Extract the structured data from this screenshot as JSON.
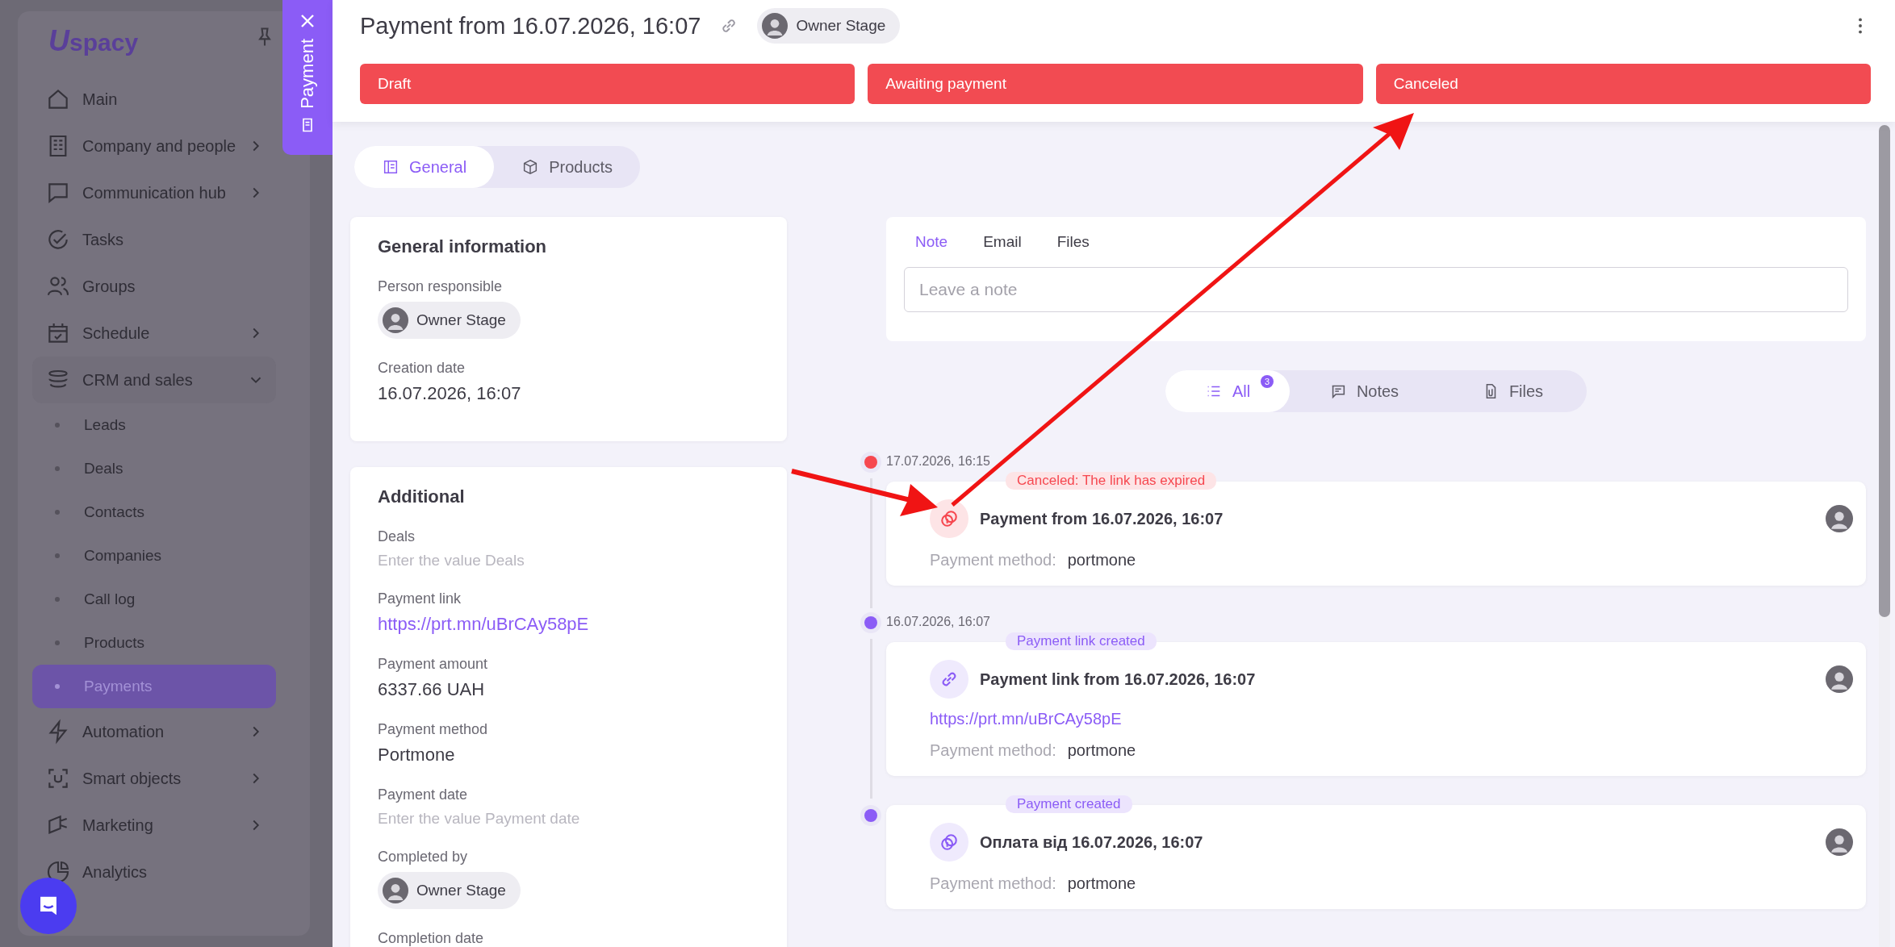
{
  "sidebar": {
    "logo": {
      "mark": "U",
      "text": "spacy"
    },
    "items": [
      {
        "label": "Main",
        "kind": "link",
        "selected": false
      },
      {
        "label": "Company and people",
        "kind": "group",
        "expanded": false,
        "selected": false
      },
      {
        "label": "Communication hub",
        "kind": "group",
        "expanded": false,
        "selected": false
      },
      {
        "label": "Tasks",
        "kind": "link",
        "selected": false
      },
      {
        "label": "Groups",
        "kind": "link",
        "selected": false
      },
      {
        "label": "Schedule",
        "kind": "group",
        "expanded": false,
        "selected": false
      },
      {
        "label": "CRM and sales",
        "kind": "group",
        "expanded": true,
        "selected": false,
        "children": [
          {
            "label": "Leads",
            "selected": false
          },
          {
            "label": "Deals",
            "selected": false
          },
          {
            "label": "Contacts",
            "selected": false
          },
          {
            "label": "Companies",
            "selected": false
          },
          {
            "label": "Call log",
            "selected": false
          },
          {
            "label": "Products",
            "selected": false
          },
          {
            "label": "Payments",
            "selected": true
          }
        ]
      },
      {
        "label": "Automation",
        "kind": "group",
        "expanded": false,
        "selected": false
      },
      {
        "label": "Smart objects",
        "kind": "group",
        "expanded": false,
        "selected": false
      },
      {
        "label": "Marketing",
        "kind": "group",
        "expanded": false,
        "selected": false
      },
      {
        "label": "Analytics",
        "kind": "link",
        "selected": false
      }
    ]
  },
  "panel_tab": {
    "label": "Payment"
  },
  "header": {
    "title": "Payment from 16.07.2026, 16:07",
    "owner": "Owner Stage"
  },
  "payment_canceled": true,
  "stages": [
    {
      "label": "Draft"
    },
    {
      "label": "Awaiting payment"
    },
    {
      "label": "Canceled"
    }
  ],
  "tabs": [
    {
      "label": "General",
      "selected": true
    },
    {
      "label": "Products",
      "selected": false
    }
  ],
  "general": {
    "title": "General information",
    "fields": [
      {
        "label": "Person responsible",
        "kind": "person",
        "value": "Owner Stage"
      },
      {
        "label": "Creation date",
        "kind": "text",
        "value": "16.07.2026, 16:07"
      }
    ]
  },
  "additional": {
    "title": "Additional",
    "fields": [
      {
        "label": "Deals",
        "kind": "empty",
        "placeholder": "Enter the value Deals"
      },
      {
        "label": "Payment link",
        "kind": "link",
        "value": "https://prt.mn/uBrCAy58pE"
      },
      {
        "label": "Payment amount",
        "kind": "text",
        "value": "6337.66 UAH"
      },
      {
        "label": "Payment method",
        "kind": "text",
        "value": "Portmone"
      },
      {
        "label": "Payment date",
        "kind": "empty",
        "placeholder": "Enter the value Payment date"
      },
      {
        "label": "Completed by",
        "kind": "person",
        "value": "Owner Stage"
      },
      {
        "label": "Completion date",
        "kind": "none"
      }
    ]
  },
  "note": {
    "tabs": [
      {
        "label": "Note",
        "selected": true
      },
      {
        "label": "Email",
        "selected": false
      },
      {
        "label": "Files",
        "selected": false
      }
    ],
    "placeholder": "Leave a note"
  },
  "filters": [
    {
      "label": "All",
      "selected": true,
      "count": "3"
    },
    {
      "label": "Notes",
      "selected": false
    },
    {
      "label": "Files",
      "selected": false
    }
  ],
  "timeline": [
    {
      "date": "17.07.2026, 16:15",
      "color": "#f6474f",
      "kind": "canceled",
      "tag": "Canceled: The link has expired",
      "title": "Payment from 16.07.2026, 16:07",
      "method_label": "Payment method:",
      "method": "portmone"
    },
    {
      "date": "16.07.2026, 16:07",
      "color": "#8b5cf6",
      "kind": "link",
      "tag": "Payment link created",
      "title": "Payment link from 16.07.2026, 16:07",
      "link": "https://prt.mn/uBrCAy58pE",
      "method_label": "Payment method:",
      "method": "portmone"
    },
    {
      "color": "#8b5cf6",
      "kind": "created",
      "tag": "Payment created",
      "title": "Оплата від 16.07.2026, 16:07",
      "method_label": "Payment method:",
      "method": "portmone"
    }
  ]
}
